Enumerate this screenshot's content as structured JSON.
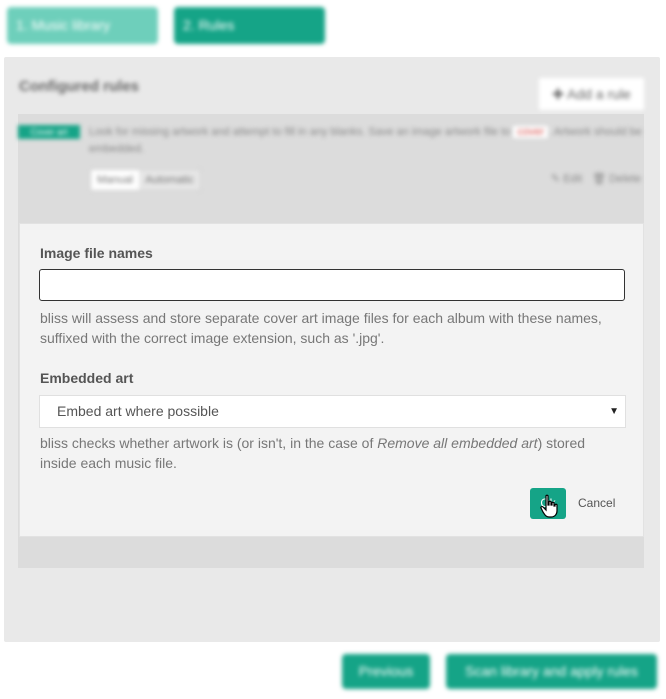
{
  "steps": [
    {
      "label": "1. Music library"
    },
    {
      "label": "2. Rules"
    }
  ],
  "panel": {
    "title": "Configured rules",
    "add_rule_label": "Add a rule",
    "add_icon": "plus-icon"
  },
  "rule": {
    "tag": "Cover art",
    "description_before": "Look for missing artwork and attempt to fill in any blanks. Save an image artwork file to",
    "description_code": "cover",
    "description_after": ". Artwork should be embedded.",
    "modes": [
      "Manual",
      "Automatic"
    ],
    "active_mode": "Manual",
    "edit_label": "Edit",
    "delete_label": "Delete",
    "edit_icon": "pencil-icon",
    "delete_icon": "trash-icon"
  },
  "modal": {
    "image_file_names_label": "Image file names",
    "image_file_names_value": "",
    "image_file_names_help": "bliss will assess and store separate cover art image files for each album with these names, suffixed with the correct image extension, such as '.jpg'.",
    "embedded_art_label": "Embedded art",
    "embedded_art_selected": "Embed art where possible",
    "embedded_help_before": "bliss checks whether artwork is (or isn't, in the case of ",
    "embedded_help_em": "Remove all embedded art",
    "embedded_help_after": ") stored inside each music file.",
    "ok_label": "Ok",
    "cancel_label": "Cancel"
  },
  "footer": {
    "previous_label": "Previous",
    "scan_label": "Scan library and apply rules"
  },
  "colors": {
    "accent": "#15a487",
    "accent_light": "#6ecfbb"
  }
}
